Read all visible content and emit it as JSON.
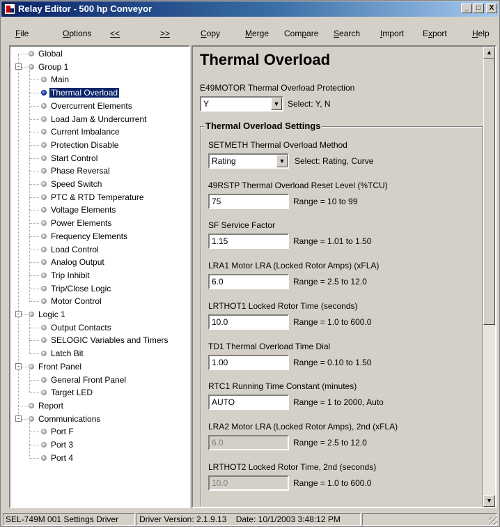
{
  "window": {
    "title": "Relay Editor - 500 hp Conveyor",
    "minimize": "_",
    "maximize": "□",
    "close": "X"
  },
  "menu": [
    {
      "pre": "",
      "ul": "F",
      "post": "ile"
    },
    {
      "pre": "",
      "ul": "O",
      "post": "ptions"
    },
    {
      "pre": "",
      "ul": "<<",
      "post": ""
    },
    {
      "pre": "",
      "ul": ">>",
      "post": ""
    },
    {
      "pre": "",
      "ul": "C",
      "post": "opy"
    },
    {
      "pre": "",
      "ul": "M",
      "post": "erge"
    },
    {
      "pre": "Com",
      "ul": "p",
      "post": "are"
    },
    {
      "pre": "",
      "ul": "S",
      "post": "earch"
    },
    {
      "pre": "",
      "ul": "I",
      "post": "mport"
    },
    {
      "pre": "E",
      "ul": "x",
      "post": "port"
    },
    {
      "pre": "",
      "ul": "H",
      "post": "elp"
    }
  ],
  "tree": [
    {
      "label": "Global",
      "level": 0
    },
    {
      "label": "Group 1",
      "level": 0,
      "expander": "-"
    },
    {
      "label": "Main",
      "level": 1
    },
    {
      "label": "Thermal Overload",
      "level": 1,
      "selected": true
    },
    {
      "label": "Overcurrent Elements",
      "level": 1
    },
    {
      "label": "Load Jam & Undercurrent",
      "level": 1
    },
    {
      "label": "Current Imbalance",
      "level": 1
    },
    {
      "label": "Protection Disable",
      "level": 1
    },
    {
      "label": "Start Control",
      "level": 1
    },
    {
      "label": "Phase Reversal",
      "level": 1
    },
    {
      "label": "Speed Switch",
      "level": 1
    },
    {
      "label": "PTC & RTD Temperature",
      "level": 1
    },
    {
      "label": "Voltage Elements",
      "level": 1
    },
    {
      "label": "Power Elements",
      "level": 1
    },
    {
      "label": "Frequency Elements",
      "level": 1
    },
    {
      "label": "Load Control",
      "level": 1
    },
    {
      "label": "Analog Output",
      "level": 1
    },
    {
      "label": "Trip Inhibit",
      "level": 1
    },
    {
      "label": "Trip/Close Logic",
      "level": 1
    },
    {
      "label": "Motor Control",
      "level": 1
    },
    {
      "label": "Logic 1",
      "level": 0,
      "expander": "-"
    },
    {
      "label": "Output Contacts",
      "level": 1
    },
    {
      "label": "SELOGIC Variables and Timers",
      "level": 1
    },
    {
      "label": "Latch Bit",
      "level": 1
    },
    {
      "label": "Front Panel",
      "level": 0,
      "expander": "-"
    },
    {
      "label": "General Front Panel",
      "level": 1
    },
    {
      "label": "Target LED",
      "level": 1
    },
    {
      "label": "Report",
      "level": 0
    },
    {
      "label": "Communications",
      "level": 0,
      "expander": "-"
    },
    {
      "label": "Port F",
      "level": 1
    },
    {
      "label": "Port 3",
      "level": 1
    },
    {
      "label": "Port 4",
      "level": 1
    }
  ],
  "panel": {
    "heading": "Thermal Overload",
    "e49": {
      "label": "E49MOTOR Thermal Overload Protection",
      "value": "Y",
      "hint": "Select: Y, N"
    },
    "group_title": "Thermal Overload Settings",
    "settings": [
      {
        "label": "SETMETH Thermal Overload Method",
        "value": "Rating",
        "hint": "Select: Rating, Curve",
        "kind": "combo"
      },
      {
        "label": "49RSTP Thermal Overload Reset Level (%TCU)",
        "value": "75",
        "hint": "Range = 10 to 99",
        "kind": "text"
      },
      {
        "label": "SF Service Factor",
        "value": "1.15",
        "hint": "Range = 1.01 to 1.50",
        "kind": "text"
      },
      {
        "label": "LRA1 Motor LRA (Locked Rotor Amps) (xFLA)",
        "value": "6.0",
        "hint": "Range = 2.5 to 12.0",
        "kind": "text"
      },
      {
        "label": "LRTHOT1 Locked Rotor Time (seconds)",
        "value": "10.0",
        "hint": "Range = 1.0 to 600.0",
        "kind": "text"
      },
      {
        "label": "TD1 Thermal Overload Time Dial",
        "value": "1.00",
        "hint": "Range = 0.10 to 1.50",
        "kind": "text"
      },
      {
        "label": "RTC1 Running Time Constant (minutes)",
        "value": "AUTO",
        "hint": "Range = 1 to 2000, Auto",
        "kind": "text"
      },
      {
        "label": "LRA2 Motor LRA (Locked Rotor Amps), 2nd (xFLA)",
        "value": "6.0",
        "hint": "Range = 2.5 to 12.0",
        "kind": "disabled"
      },
      {
        "label": "LRTHOT2 Locked Rotor Time, 2nd (seconds)",
        "value": "10.0",
        "hint": "Range = 1.0 to 600.0",
        "kind": "disabled"
      }
    ]
  },
  "status": {
    "driver": "SEL-749M 001 Settings Driver",
    "version": "Driver Version: 2.1.9.13",
    "date": "Date: 10/1/2003 3:48:12 PM"
  },
  "icons": {
    "dropdown": "chevron-down-icon",
    "scroll_up": "arrow-up-icon",
    "scroll_down": "arrow-down-icon"
  },
  "colors": {
    "titlebar": "#0a246a",
    "selection": "#0a246a",
    "face": "#d4d0c8"
  }
}
